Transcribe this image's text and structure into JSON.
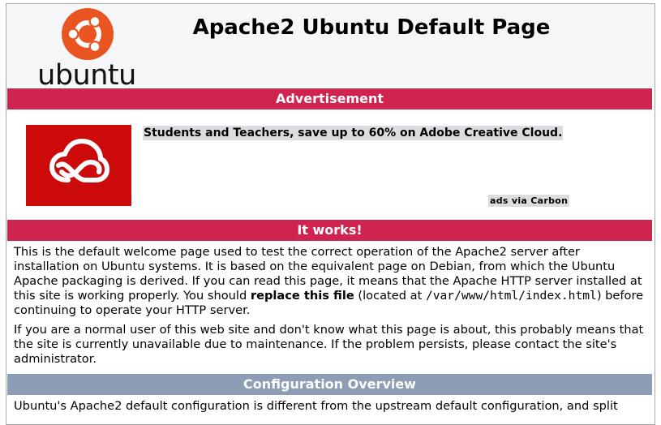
{
  "header": {
    "logo_word": "ubuntu",
    "title": "Apache2 Ubuntu Default Page"
  },
  "advertisement": {
    "heading": "Advertisement",
    "text": "Students and Teachers, save up to 60% on Adobe Creative Cloud.",
    "via": "ads via Carbon"
  },
  "it_works": {
    "heading": "It works!",
    "p1_before": "This is the default welcome page used to test the correct operation of the Apache2 server after installation on Ubuntu systems. It is based on the equivalent page on Debian, from which the Ubuntu Apache packaging is derived. If you can read this page, it means that the Apache HTTP server installed at this site is working properly. You should ",
    "p1_strong": "replace this file",
    "p1_mid": " (located at ",
    "p1_code": "/var/www/html/index.html",
    "p1_after": ") before continuing to operate your HTTP server.",
    "p2": "If you are a normal user of this web site and don't know what this page is about, this probably means that the site is currently unavailable due to maintenance. If the problem persists, please contact the site's administrator."
  },
  "config": {
    "heading": "Configuration Overview",
    "p1": "Ubuntu's Apache2 default configuration is different from the upstream default configuration, and split"
  },
  "colors": {
    "section_red": "#cf2350",
    "section_gray": "#8c9db5",
    "ubuntu_orange": "#e95420",
    "adobe_red": "#cc0a0a"
  }
}
